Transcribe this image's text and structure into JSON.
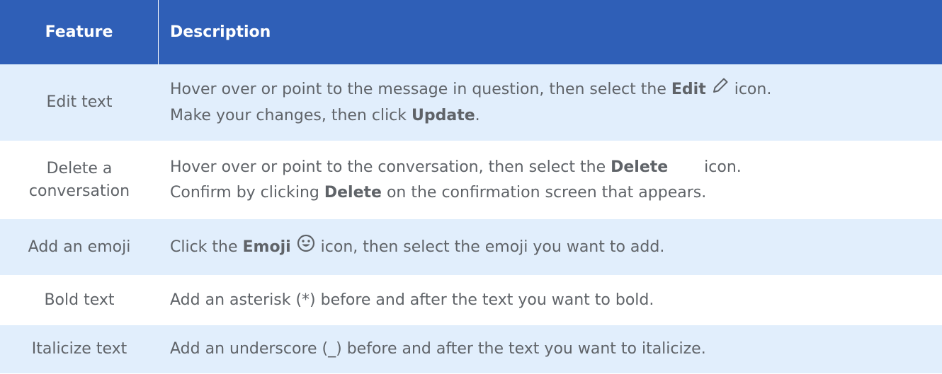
{
  "header": {
    "feature": "Feature",
    "description": "Description"
  },
  "rows": [
    {
      "feature": "Edit text",
      "d1": "Hover over or point to the message in question, then select the ",
      "d1_bold": "Edit",
      "d1_end": " icon.",
      "d2": "Make your changes, then click ",
      "d2_bold": "Update",
      "d2_end": ".",
      "icon": "pencil-icon"
    },
    {
      "feature_l1": "Delete a",
      "feature_l2": "conversation",
      "d1": "Hover over or point to the conversation, then select the ",
      "d1_bold": "Delete",
      "d1_end": " icon.",
      "d2": "Confirm by clicking ",
      "d2_bold": "Delete",
      "d2_end": " on the confirmation screen that appears.",
      "icon": "delete-icon"
    },
    {
      "feature": "Add an emoji",
      "d1": "Click the ",
      "d1_bold": "Emoji",
      "d1_end": " icon, then select the emoji you want to add.",
      "icon": "smiley-icon"
    },
    {
      "feature": "Bold text",
      "d1": "Add an asterisk (*) before and after the text you want to bold."
    },
    {
      "feature": "Italicize text",
      "d1": "Add an underscore (_) before and after the text you want to italicize."
    }
  ],
  "colors": {
    "header_bg": "#2f5fb7",
    "shade_bg": "#e1eefc",
    "text": "#5f6368"
  }
}
